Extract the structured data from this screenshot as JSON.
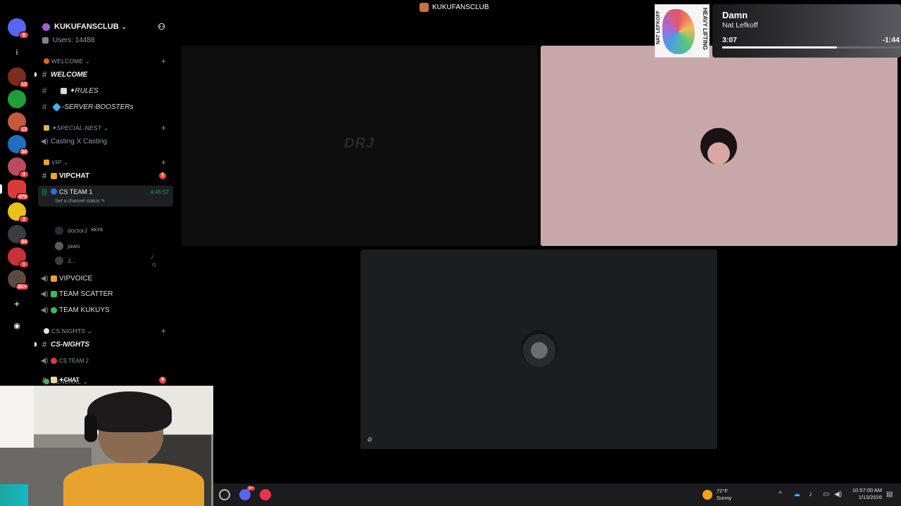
{
  "window": {
    "title": "KUKUFANSCLUB"
  },
  "rail": {
    "badges": [
      "9",
      "13",
      "13",
      "34",
      "3",
      "470",
      "3",
      "34",
      "1",
      "2K+"
    ]
  },
  "server": {
    "name": "KUKUFANSCLUB",
    "users": "Users: 14488"
  },
  "channels": {
    "cat_welcome": "WELCOME",
    "welcome": "WELCOME",
    "rules": "✦RULES",
    "boosters": "-SERVER-BOOSTERs",
    "cat_special": "✦Special-Nest",
    "casting": "Casting X Casting",
    "cat_vip": "VIP",
    "vipchat": "VIPCHAT",
    "vipchat_badge": "1",
    "cs_team1": "CS TEAM 1",
    "cs_team1_timer": "4:45:57",
    "cs_team1_status": "Set a channel status",
    "voice_user1": "doctorJ",
    "voice_user1_tag": "KKYS",
    "voice_user2": "jawo",
    "voice_user3": "J...",
    "vipvoice": "VIPVOICE",
    "team_scatter": "TEAM SCATTER",
    "team_kukuys": "TEAM KUKUYS",
    "cat_csnights": "CS NIGHTS",
    "csnights": "CS-NIGHTS",
    "cs_team2": "CS TEAM 2",
    "cat_general": "GENERAL",
    "chat": "✦CHAT",
    "chat_badge": "9"
  },
  "stage": {
    "watermark": "DRJ"
  },
  "now_playing": {
    "song": "Damn",
    "artist": "Nat Lefkoff",
    "elapsed": "3:07",
    "remaining": "-1:44",
    "progress": 0.64,
    "album_text_left": "NAT LEFKOFF",
    "album_text_right": "HEAVY LIFTING"
  },
  "taskbar": {
    "discord_badge": "9+",
    "weather_temp": "72°F",
    "weather_cond": "Sunny",
    "time": "10:57:00 AM",
    "date": "1/13/2026"
  },
  "colors": {
    "accent_red": "#f23f43",
    "voice_green": "#23a55a",
    "pink_tile": "#c8a7a8"
  }
}
